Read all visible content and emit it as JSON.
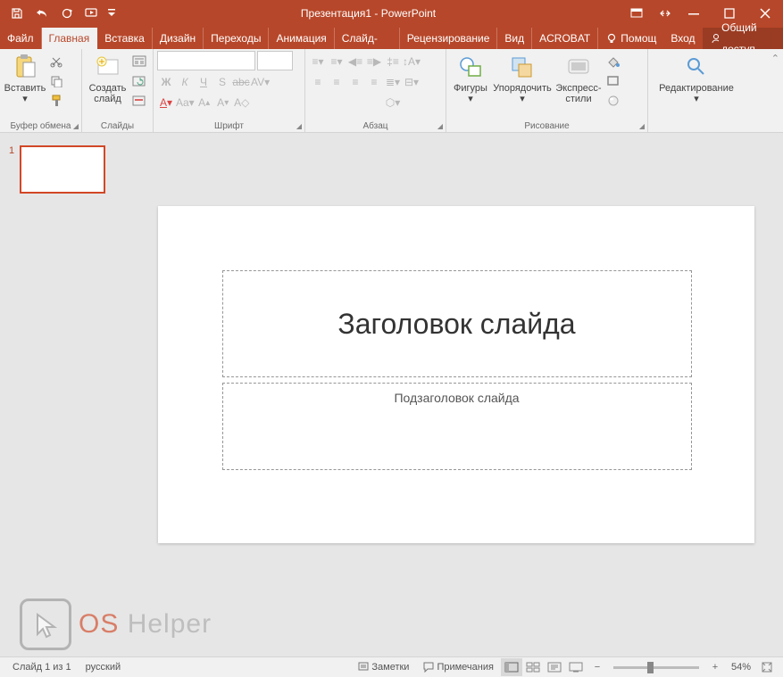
{
  "titlebar": {
    "title": "Презентация1 - PowerPoint"
  },
  "tabs": {
    "items": [
      "Файл",
      "Главная",
      "Вставка",
      "Дизайн",
      "Переходы",
      "Анимация",
      "Слайд-шоу",
      "Рецензирование",
      "Вид",
      "ACROBAT"
    ],
    "active_index": 1,
    "tell_me": "Помощ",
    "signin": "Вход",
    "share": "Общий доступ"
  },
  "ribbon": {
    "groups": {
      "clipboard": {
        "label": "Буфер обмена",
        "paste": "Вставить"
      },
      "slides": {
        "label": "Слайды",
        "new_slide": "Создать\nслайд"
      },
      "font": {
        "label": "Шрифт"
      },
      "paragraph": {
        "label": "Абзац"
      },
      "drawing": {
        "label": "Рисование",
        "shapes": "Фигуры",
        "arrange": "Упорядочить",
        "quick_styles": "Экспресс-\nстили"
      },
      "editing": {
        "label": "",
        "edit": "Редактирование"
      }
    }
  },
  "slide": {
    "title_placeholder": "Заголовок слайда",
    "subtitle_placeholder": "Подзаголовок слайда"
  },
  "thumbs": {
    "current": "1"
  },
  "statusbar": {
    "slide_info": "Слайд 1 из 1",
    "language": "русский",
    "notes": "Заметки",
    "comments": "Примечания",
    "zoom": "54%"
  },
  "watermark": {
    "os": "OS",
    "helper": "Helper"
  }
}
